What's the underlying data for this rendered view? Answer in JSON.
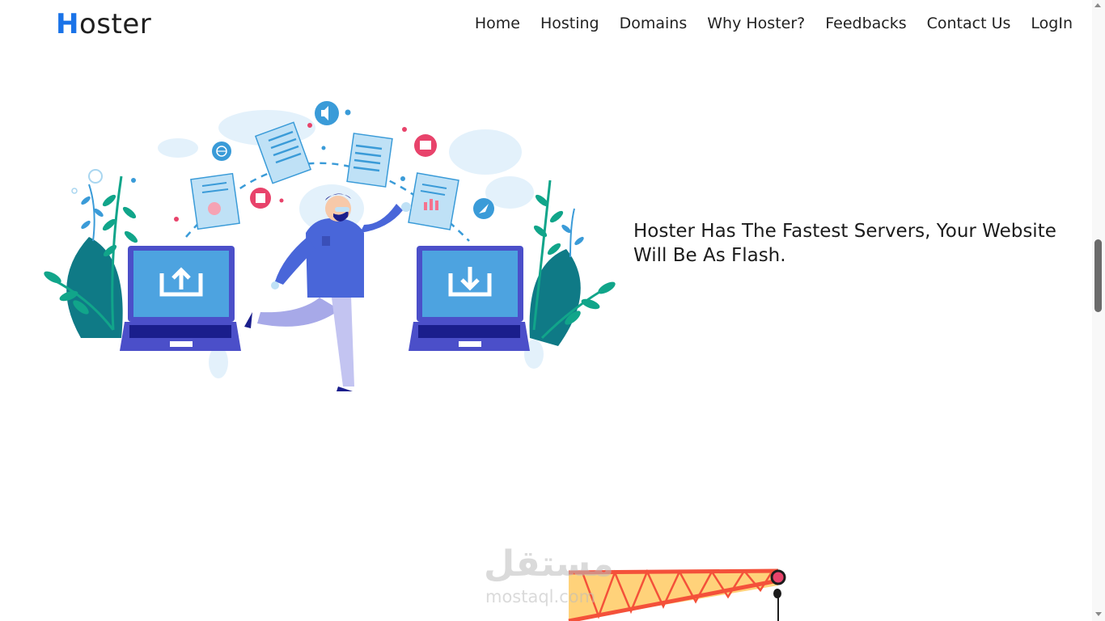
{
  "logo": {
    "first_letter": "H",
    "rest": "oster"
  },
  "nav": {
    "items": [
      "Home",
      "Hosting",
      "Domains",
      "Why Hoster?",
      "Feedbacks",
      "Contact Us",
      "LogIn"
    ]
  },
  "hero": {
    "headline": "Hoster Has The Fastest Servers, Your Website Will Be As Flash."
  },
  "watermark": {
    "arabic": "مستقل",
    "latin": "mostaql.com"
  },
  "colors": {
    "brand_blue": "#1a73e8",
    "laptop_body": "#4b4fc9",
    "laptop_screen": "#4da3e0",
    "plant_teal": "#0f7a86",
    "plant_green": "#11a58a",
    "accent_pink": "#e8436b",
    "crane_orange": "#f4513a",
    "crane_fill": "#ffd27a"
  },
  "icons": [
    "upload-icon",
    "download-icon",
    "globe-icon",
    "speaker-icon",
    "book-icon",
    "pointer-icon",
    "save-icon"
  ]
}
